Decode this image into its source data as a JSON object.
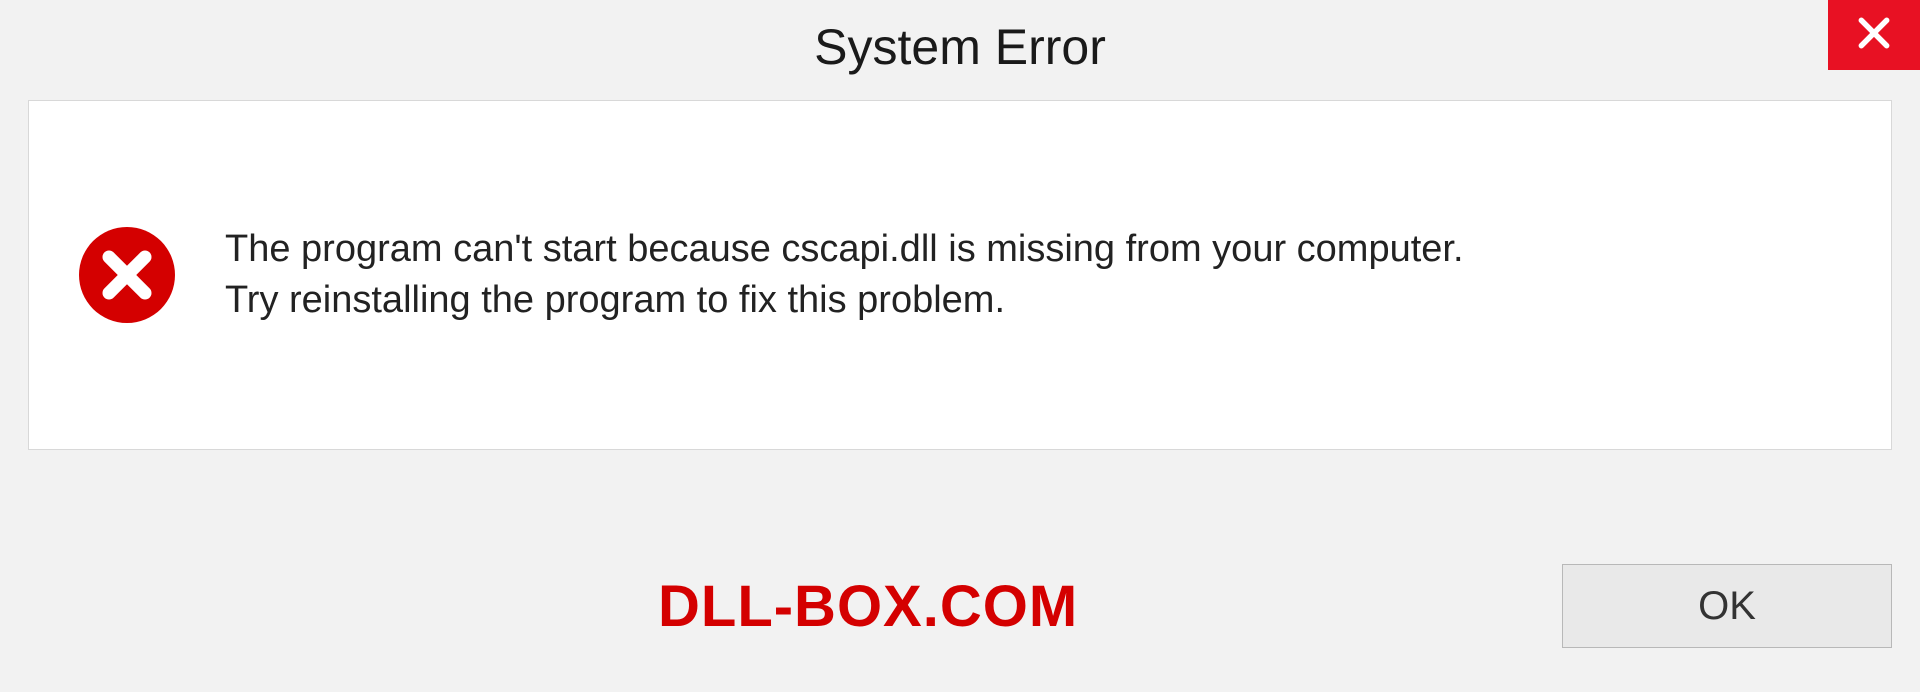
{
  "dialog": {
    "title": "System Error",
    "message_line1": "The program can't start because cscapi.dll is missing from your computer.",
    "message_line2": "Try reinstalling the program to fix this problem.",
    "ok_label": "OK"
  },
  "watermark": "DLL-BOX.COM",
  "colors": {
    "close_bg": "#e81123",
    "error_icon": "#d40000",
    "watermark_text": "#d40000"
  }
}
